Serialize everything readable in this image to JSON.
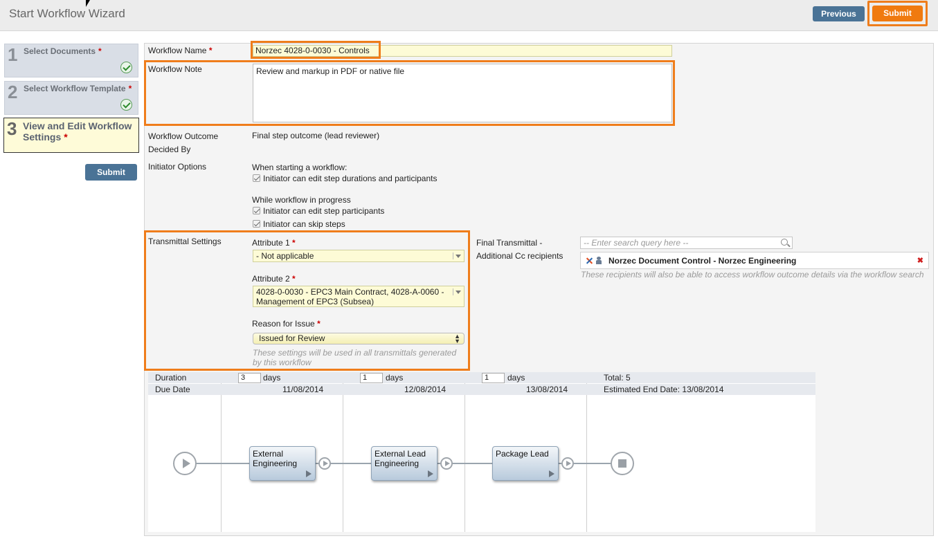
{
  "header": {
    "title": "Start Workflow Wizard",
    "previous_label": "Previous",
    "submit_label": "Submit"
  },
  "steps": [
    {
      "num": "1",
      "label": "Select Documents",
      "star": "*",
      "done": true
    },
    {
      "num": "2",
      "label": "Select Workflow Template",
      "star": "*",
      "done": true
    },
    {
      "num": "3",
      "label": "View and Edit Workflow Settings",
      "star": "*",
      "done": false
    }
  ],
  "sidebar": {
    "submit_label": "Submit"
  },
  "form": {
    "workflow_name_label": "Workflow Name",
    "workflow_name_value": "Norzec 4028-0-0030 - Controls",
    "workflow_note_label": "Workflow Note",
    "workflow_note_value": "Review and markup in PDF or native file",
    "outcome_label": "Workflow Outcome Decided By",
    "outcome_value": "Final step outcome (lead reviewer)",
    "initiator_label": "Initiator Options",
    "when_starting": "When starting a workflow:",
    "opt_edit_durations": "Initiator can edit step durations and participants",
    "while_in_progress": "While workflow in progress",
    "opt_edit_participants": "Initiator can edit step participants",
    "opt_skip_steps": "Initiator can skip steps",
    "required_mark": "*"
  },
  "transmittal": {
    "label": "Transmittal Settings",
    "attr1_label": "Attribute 1",
    "attr1_value": "- Not applicable",
    "attr2_label": "Attribute 2",
    "attr2_value": "4028-0-0030 - EPC3 Main Contract, 4028-A-0060 - Management of EPC3 (Subsea)",
    "reason_label": "Reason for Issue",
    "reason_value": "Issued for Review",
    "hint": "These settings will be used in all transmittals generated by this workflow"
  },
  "cc": {
    "label": "Final Transmittal - Additional Cc recipients",
    "search_placeholder": "-- Enter search query here --",
    "recipient": "Norzec Document Control - Norzec Engineering",
    "remove": "✖",
    "hint": "These recipients will also be able to access workflow outcome details via the workflow search"
  },
  "schedule": {
    "duration_label": "Duration",
    "due_date_label": "Due Date",
    "days_label": "days",
    "durations": [
      "3",
      "1",
      "1"
    ],
    "due_dates": [
      "11/08/2014",
      "12/08/2014",
      "13/08/2014"
    ],
    "total": "Total: 5",
    "estimated_end": "Estimated End Date: 13/08/2014"
  },
  "diagram": {
    "nodes": [
      "External Engineering",
      "External Lead Engineering",
      "Package Lead"
    ]
  },
  "colors": {
    "highlight": "#ef7d1b",
    "primary_button": "#4a7396",
    "accent_button": "#f07a0f"
  }
}
